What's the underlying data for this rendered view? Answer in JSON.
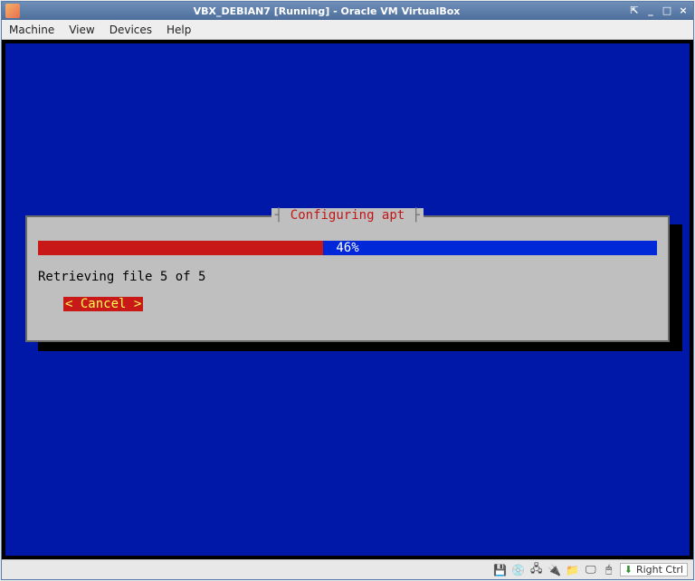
{
  "window": {
    "title": "VBX_DEBIAN7 [Running] - Oracle VM VirtualBox",
    "controls": {
      "pin": "⇱",
      "min": "_",
      "max": "□",
      "close": "×"
    }
  },
  "menu": {
    "machine": "Machine",
    "view": "View",
    "devices": "Devices",
    "help": "Help"
  },
  "installer": {
    "dialog_title": "Configuring apt",
    "progress_percent": 46,
    "progress_label": "46%",
    "status": "Retrieving file 5 of 5",
    "cancel": "Cancel"
  },
  "status": {
    "hostkey": "Right Ctrl"
  }
}
